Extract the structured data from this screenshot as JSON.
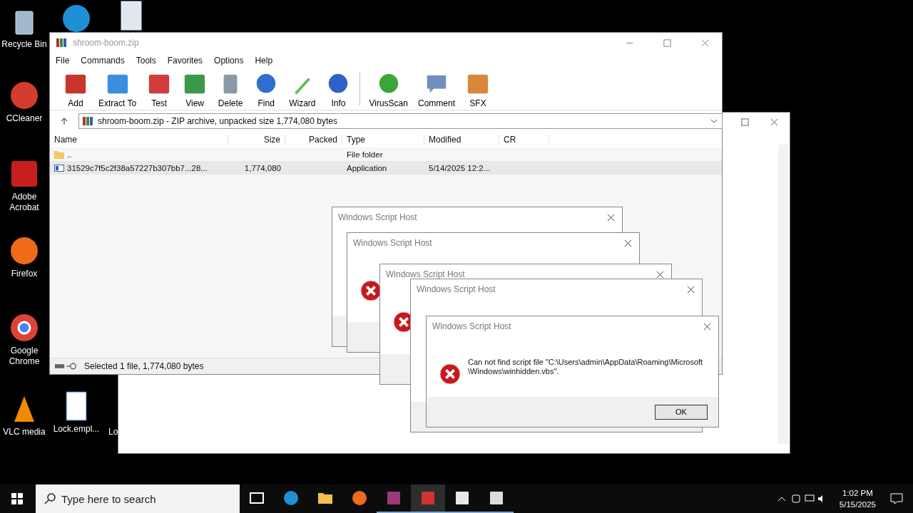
{
  "desktop_icons": [
    {
      "kind": "recycle",
      "label": "Recycle Bin"
    },
    {
      "kind": "edge"
    },
    {
      "kind": "image"
    },
    {
      "kind": "ccleaner",
      "label": "CCleaner"
    },
    {
      "kind": "acrobat",
      "label": "Adobe Acrobat"
    },
    {
      "kind": "firefox",
      "label": "Firefox"
    },
    {
      "kind": "chrome",
      "label": "Google Chrome"
    },
    {
      "kind": "vlc",
      "label": "VLC media"
    },
    {
      "kind": "word",
      "label": "Lock.empl..."
    },
    {
      "kind": "none",
      "label": "Lo"
    }
  ],
  "back_window": {
    "kind": "blank"
  },
  "archiver": {
    "title": "shroom-boom.zip",
    "menu": [
      "File",
      "Commands",
      "Tools",
      "Favorites",
      "Options",
      "Help"
    ],
    "toolbar": [
      {
        "kind": "add",
        "label": "Add"
      },
      {
        "kind": "extract",
        "label": "Extract To"
      },
      {
        "kind": "test",
        "label": "Test"
      },
      {
        "kind": "view",
        "label": "View"
      },
      {
        "kind": "delete",
        "label": "Delete"
      },
      {
        "kind": "find",
        "label": "Find"
      },
      {
        "kind": "wizard",
        "label": "Wizard"
      },
      {
        "kind": "info",
        "label": "Info"
      },
      {
        "kind": "virus",
        "label": "VirusScan"
      },
      {
        "kind": "comment",
        "label": "Comment"
      },
      {
        "kind": "sfx",
        "label": "SFX"
      }
    ],
    "address": "shroom-boom.zip - ZIP archive, unpacked size 1,774,080 bytes",
    "columns": [
      "Name",
      "Size",
      "Packed",
      "Type",
      "Modified",
      "CR"
    ],
    "rows": [
      {
        "kind": "folder",
        "name": "..",
        "size": "",
        "packed": "",
        "type": "File folder",
        "modified": "",
        "selected": false
      },
      {
        "kind": "app",
        "name": "31529c7f5c2f38a57227b307bb7...28...",
        "size": "1,774,080",
        "packed": "",
        "type": "Application",
        "modified": "5/14/2025 12:2...",
        "selected": true
      }
    ],
    "status": "Selected 1 file, 1,774,080 bytes"
  },
  "dialogs": [
    {
      "title": "Windows Script Host"
    },
    {
      "title": "Windows Script Host",
      "icon": true
    },
    {
      "title": "Windows Script Host",
      "icon": true
    },
    {
      "title": "Windows Script Host"
    },
    {
      "title": "Windows Script Host",
      "icon": true,
      "message": "Can not find script file \"C:\\Users\\admin\\AppData\\Roaming\\Microsoft\\Windows\\winhidden.vbs\".",
      "button": "OK"
    }
  ],
  "taskbar": {
    "search_placeholder": "Type here to search",
    "apps": [
      {
        "kind": "taskview",
        "running": false,
        "selected": false
      },
      {
        "kind": "edge",
        "running": false,
        "selected": false
      },
      {
        "kind": "explorer",
        "running": false,
        "selected": false
      },
      {
        "kind": "firefox",
        "running": false,
        "selected": false
      },
      {
        "kind": "winrar",
        "running": true,
        "selected": false
      },
      {
        "kind": "script",
        "running": true,
        "selected": true
      },
      {
        "kind": "doc",
        "running": true,
        "selected": false
      },
      {
        "kind": "window",
        "running": true,
        "selected": false
      }
    ],
    "time": "1:02 PM",
    "date": "5/15/2025"
  }
}
